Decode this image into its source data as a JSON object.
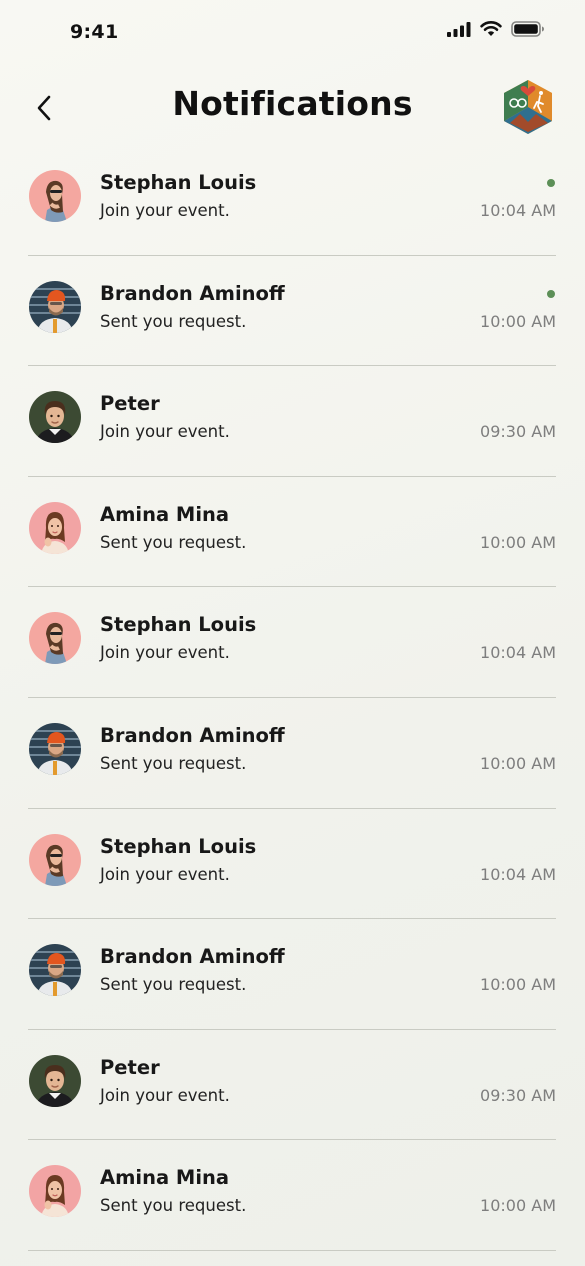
{
  "status_bar": {
    "time": "9:41"
  },
  "header": {
    "title": "Notifications"
  },
  "colors": {
    "unread_dot": "#5c8f57",
    "divider": "#c9cbc3",
    "time_text": "#7e7e7e"
  },
  "notifications": [
    {
      "name": "Stephan Louis",
      "message": "Join your event.",
      "time": "10:04 AM",
      "unread": true,
      "avatar": "stephan"
    },
    {
      "name": "Brandon Aminoff",
      "message": "Sent you request.",
      "time": "10:00 AM",
      "unread": true,
      "avatar": "brandon"
    },
    {
      "name": "Peter",
      "message": "Join your event.",
      "time": "09:30 AM",
      "unread": false,
      "avatar": "peter"
    },
    {
      "name": "Amina Mina",
      "message": "Sent you request.",
      "time": "10:00 AM",
      "unread": false,
      "avatar": "amina"
    },
    {
      "name": "Stephan Louis",
      "message": "Join your event.",
      "time": "10:04 AM",
      "unread": false,
      "avatar": "stephan"
    },
    {
      "name": "Brandon Aminoff",
      "message": "Sent you request.",
      "time": "10:00 AM",
      "unread": false,
      "avatar": "brandon"
    },
    {
      "name": "Stephan Louis",
      "message": "Join your event.",
      "time": "10:04 AM",
      "unread": false,
      "avatar": "stephan"
    },
    {
      "name": "Brandon Aminoff",
      "message": "Sent you request.",
      "time": "10:00 AM",
      "unread": false,
      "avatar": "brandon"
    },
    {
      "name": "Peter",
      "message": "Join your event.",
      "time": "09:30 AM",
      "unread": false,
      "avatar": "peter"
    },
    {
      "name": "Amina Mina",
      "message": "Sent you request.",
      "time": "10:00 AM",
      "unread": false,
      "avatar": "amina"
    }
  ]
}
